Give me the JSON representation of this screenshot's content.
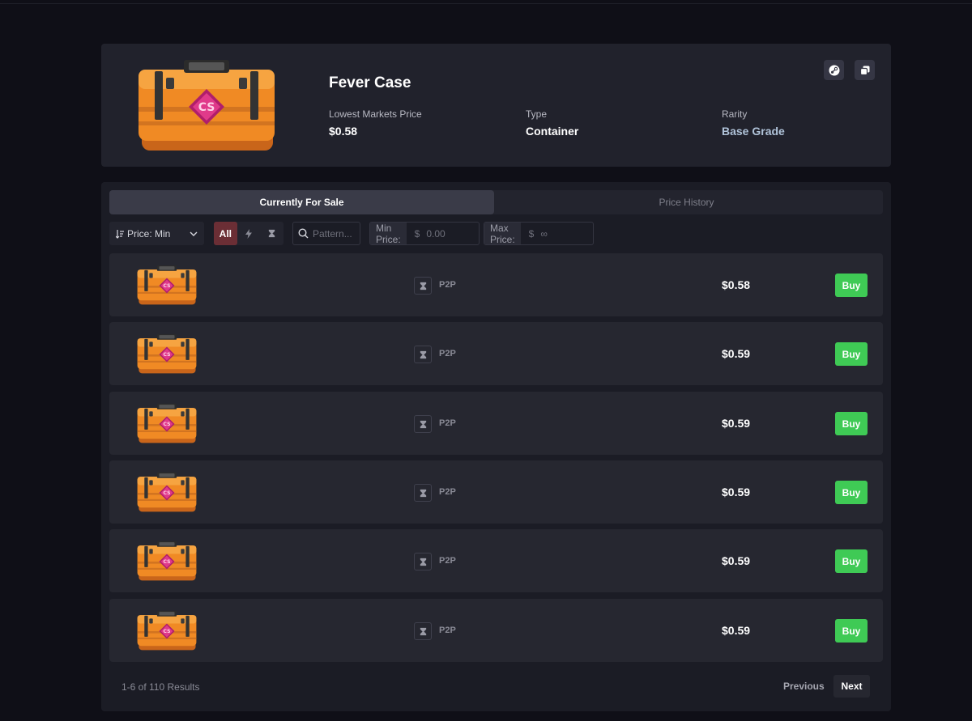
{
  "item": {
    "name": "Fever Case",
    "lowest_label": "Lowest Markets Price",
    "lowest_value": "$0.58",
    "type_label": "Type",
    "type_value": "Container",
    "rarity_label": "Rarity",
    "rarity_value": "Base Grade",
    "icons": [
      "steam-icon",
      "copy-icon"
    ],
    "case_logo_text": "CS",
    "colors": {
      "case_orange": "#f08a24",
      "rarity": "#b0c3d9"
    }
  },
  "tabs": [
    {
      "label": "Currently For Sale",
      "active": true
    },
    {
      "label": "Price History",
      "active": false
    }
  ],
  "filters": {
    "sort_label": "Price: Min",
    "seg_all": "All",
    "seg_icons": [
      "bolt-icon",
      "hourglass-icon"
    ],
    "search_placeholder": "Pattern...",
    "min_label": "Min Price:",
    "min_currency": "$",
    "min_placeholder": "0.00",
    "max_label": "Max Price:",
    "max_currency": "$",
    "max_placeholder": "∞"
  },
  "listings": [
    {
      "method": "P2P",
      "price": "$0.58",
      "action": "Buy"
    },
    {
      "method": "P2P",
      "price": "$0.59",
      "action": "Buy"
    },
    {
      "method": "P2P",
      "price": "$0.59",
      "action": "Buy"
    },
    {
      "method": "P2P",
      "price": "$0.59",
      "action": "Buy"
    },
    {
      "method": "P2P",
      "price": "$0.59",
      "action": "Buy"
    },
    {
      "method": "P2P",
      "price": "$0.59",
      "action": "Buy"
    }
  ],
  "pagination": {
    "results": "1-6 of 110 Results",
    "previous": "Previous",
    "next": "Next"
  }
}
